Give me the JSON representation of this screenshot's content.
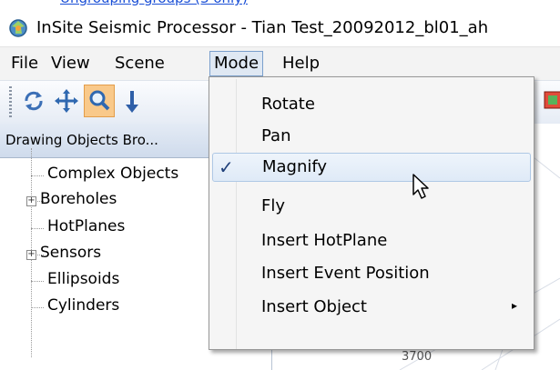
{
  "header_link_fragment": "(partially visible text above the title bar)",
  "window": {
    "title": "InSite Seismic Processor - Tian Test_20092012_bl01_ah"
  },
  "menubar": {
    "items": [
      {
        "label": "File"
      },
      {
        "label": "View"
      },
      {
        "label": "Scene"
      },
      {
        "label": "Mode"
      },
      {
        "label": "Help"
      }
    ]
  },
  "toolbar": {
    "buttons": [
      {
        "icon": "rotate-icon"
      },
      {
        "icon": "pan-icon"
      },
      {
        "icon": "magnify-icon",
        "active": true
      },
      {
        "icon": "fly-icon"
      }
    ]
  },
  "panel": {
    "title": "Drawing Objects Bro...",
    "tree": [
      {
        "label": "Complex Objects",
        "expandable": false
      },
      {
        "label": "Boreholes",
        "expandable": true
      },
      {
        "label": "HotPlanes",
        "expandable": false
      },
      {
        "label": "Sensors",
        "expandable": true
      },
      {
        "label": "Ellipsoids",
        "expandable": false
      },
      {
        "label": "Cylinders",
        "expandable": false
      }
    ]
  },
  "canvas": {
    "axis_label": "3700"
  },
  "mode_menu": {
    "items": [
      {
        "label": "Rotate",
        "checked": false
      },
      {
        "label": "Pan",
        "checked": false
      },
      {
        "label": "Magnify",
        "checked": true
      },
      {
        "label": "Fly",
        "checked": false
      },
      {
        "label": "Insert HotPlane",
        "checked": false
      },
      {
        "label": "Insert Event Position",
        "checked": false
      },
      {
        "label": "Insert Object",
        "checked": false,
        "submenu": true
      }
    ],
    "check_glyph": "✓",
    "submenu_glyph": "▸"
  },
  "colors": {
    "active_tool_bg": "#f9c98a",
    "selected_item_bg": "#dfeaf7",
    "link_blue": "#1a4fd6"
  }
}
